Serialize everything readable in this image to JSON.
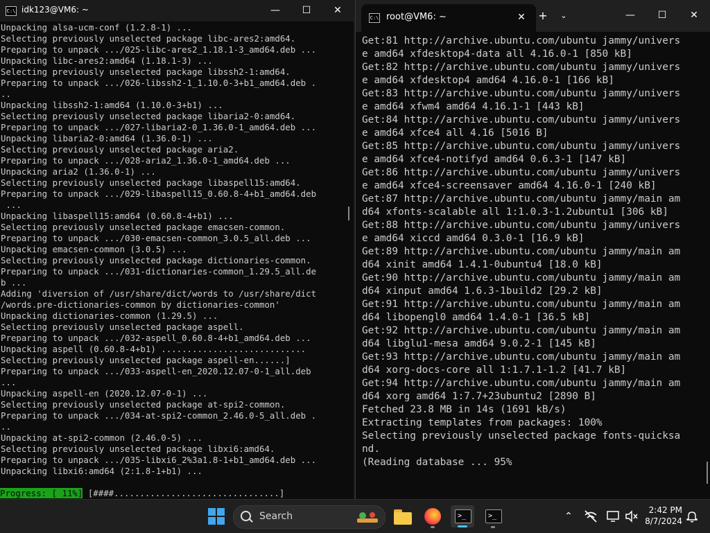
{
  "left_window": {
    "title": "idk123@VM6: ~",
    "lines": [
      "Unpacking alsa-ucm-conf (1.2.8-1) ...",
      "Selecting previously unselected package libc-ares2:amd64.",
      "Preparing to unpack .../025-libc-ares2_1.18.1-3_amd64.deb ...",
      "Unpacking libc-ares2:amd64 (1.18.1-3) ...",
      "Selecting previously unselected package libssh2-1:amd64.",
      "Preparing to unpack .../026-libssh2-1_1.10.0-3+b1_amd64.deb .",
      "..",
      "Unpacking libssh2-1:amd64 (1.10.0-3+b1) ...",
      "Selecting previously unselected package libaria2-0:amd64.",
      "Preparing to unpack .../027-libaria2-0_1.36.0-1_amd64.deb ...",
      "Unpacking libaria2-0:amd64 (1.36.0-1) ...",
      "Selecting previously unselected package aria2.",
      "Preparing to unpack .../028-aria2_1.36.0-1_amd64.deb ...",
      "Unpacking aria2 (1.36.0-1) ...",
      "Selecting previously unselected package libaspell15:amd64.",
      "Preparing to unpack .../029-libaspell15_0.60.8-4+b1_amd64.deb",
      " ...",
      "Unpacking libaspell15:amd64 (0.60.8-4+b1) ...",
      "Selecting previously unselected package emacsen-common.",
      "Preparing to unpack .../030-emacsen-common_3.0.5_all.deb ...",
      "Unpacking emacsen-common (3.0.5) ...",
      "Selecting previously unselected package dictionaries-common.",
      "Preparing to unpack .../031-dictionaries-common_1.29.5_all.de",
      "b ...",
      "Adding 'diversion of /usr/share/dict/words to /usr/share/dict",
      "/words.pre-dictionaries-common by dictionaries-common'",
      "Unpacking dictionaries-common (1.29.5) ...",
      "Selecting previously unselected package aspell.",
      "Preparing to unpack .../032-aspell_0.60.8-4+b1_amd64.deb ...",
      "Unpacking aspell (0.60.8-4+b1) ............................",
      "Selecting previously unselected package aspell-en......]",
      "Preparing to unpack .../033-aspell-en_2020.12.07-0-1_all.deb",
      "...",
      "Unpacking aspell-en (2020.12.07-0-1) ...",
      "Selecting previously unselected package at-spi2-common.",
      "Preparing to unpack .../034-at-spi2-common_2.46.0-5_all.deb .",
      "..",
      "Unpacking at-spi2-common (2.46.0-5) ...",
      "Selecting previously unselected package libxi6:amd64.",
      "Preparing to unpack .../035-libxi6_2%3a1.8-1+b1_amd64.deb ...",
      "Unpacking libxi6:amd64 (2:1.8-1+b1) ..."
    ],
    "progress_label": "Progress: [ 11%]",
    "progress_bar": " [####................................]",
    "progress_fraction": 0.11
  },
  "right_window": {
    "tab_title": "root@VM6: ~",
    "new_tab": "+",
    "lines": [
      "Get:81 http://archive.ubuntu.com/ubuntu jammy/univers",
      "e amd64 xfdesktop4-data all 4.16.0-1 [850 kB]",
      "Get:82 http://archive.ubuntu.com/ubuntu jammy/univers",
      "e amd64 xfdesktop4 amd64 4.16.0-1 [166 kB]",
      "Get:83 http://archive.ubuntu.com/ubuntu jammy/univers",
      "e amd64 xfwm4 amd64 4.16.1-1 [443 kB]",
      "Get:84 http://archive.ubuntu.com/ubuntu jammy/univers",
      "e amd64 xfce4 all 4.16 [5016 B]",
      "Get:85 http://archive.ubuntu.com/ubuntu jammy/univers",
      "e amd64 xfce4-notifyd amd64 0.6.3-1 [147 kB]",
      "Get:86 http://archive.ubuntu.com/ubuntu jammy/univers",
      "e amd64 xfce4-screensaver amd64 4.16.0-1 [240 kB]",
      "Get:87 http://archive.ubuntu.com/ubuntu jammy/main am",
      "d64 xfonts-scalable all 1:1.0.3-1.2ubuntu1 [306 kB]",
      "Get:88 http://archive.ubuntu.com/ubuntu jammy/univers",
      "e amd64 xiccd amd64 0.3.0-1 [16.9 kB]",
      "Get:89 http://archive.ubuntu.com/ubuntu jammy/main am",
      "d64 xinit amd64 1.4.1-0ubuntu4 [18.0 kB]",
      "Get:90 http://archive.ubuntu.com/ubuntu jammy/main am",
      "d64 xinput amd64 1.6.3-1build2 [29.2 kB]",
      "Get:91 http://archive.ubuntu.com/ubuntu jammy/main am",
      "d64 libopengl0 amd64 1.4.0-1 [36.5 kB]",
      "Get:92 http://archive.ubuntu.com/ubuntu jammy/main am",
      "d64 libglu1-mesa amd64 9.0.2-1 [145 kB]",
      "Get:93 http://archive.ubuntu.com/ubuntu jammy/main am",
      "d64 xorg-docs-core all 1:1.7.1-1.2 [41.7 kB]",
      "Get:94 http://archive.ubuntu.com/ubuntu jammy/main am",
      "d64 xorg amd64 1:7.7+23ubuntu2 [2890 B]",
      "Fetched 23.8 MB in 14s (1691 kB/s)",
      "Extracting templates from packages: 100%",
      "Selecting previously unselected package fonts-quicksa",
      "nd.",
      "(Reading database ... 95%"
    ]
  },
  "window_controls": {
    "minimize": "—",
    "maximize": "☐",
    "close": "✕"
  },
  "taskbar": {
    "search_placeholder": "Search",
    "clock_time": "2:42 PM",
    "clock_date": "8/7/2024",
    "apps": [
      "start-icon",
      "search-icon",
      "file-explorer-icon",
      "firefox-icon",
      "terminal-icon",
      "terminal-icon"
    ],
    "tray_icons": [
      "chevron-up-icon",
      "network-off-icon",
      "display-icon",
      "speaker-muted-icon",
      "bell-icon"
    ],
    "accent_color": "#4cc2ff"
  },
  "colors": {
    "terminal_bg": "#0c0c0c",
    "terminal_text": "#cccccc",
    "progress_green": "#19a319"
  }
}
